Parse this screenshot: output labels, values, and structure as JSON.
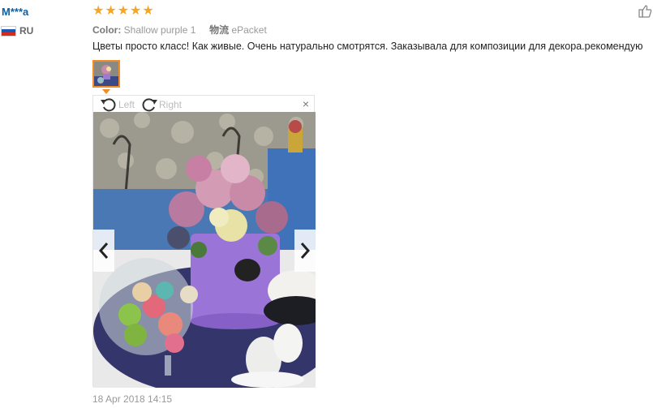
{
  "reviewer": {
    "name": "M***a",
    "country_code": "RU",
    "flag_colors": [
      "#ffffff",
      "#1c57b5",
      "#d52b1e"
    ]
  },
  "review": {
    "rating": 5,
    "stars": [
      "★",
      "★",
      "★",
      "★",
      "★"
    ],
    "color_label": "Color:",
    "color_value": "Shallow purple 1",
    "shipping_label": "物流",
    "shipping_value": "ePacket",
    "text": "Цветы просто класс! Как живые. Очень натурально смотрятся. Заказывала для композиции для декора.рекомендую",
    "date": "18 Apr 2018 14:15"
  },
  "viewer": {
    "rotate_left_label": "Left",
    "rotate_right_label": "Right",
    "close_glyph": "×",
    "photo_count": 1
  },
  "icons": {
    "rotate_left": "rotate-left-icon",
    "rotate_right": "rotate-right-icon",
    "close": "close-icon",
    "prev": "chevron-left-icon",
    "next": "chevron-right-icon",
    "helpful": "thumbs-up-icon",
    "star": "star-icon"
  },
  "colors": {
    "accent": "#f28c28",
    "star": "#f5a623",
    "name": "#0b5fa5"
  }
}
